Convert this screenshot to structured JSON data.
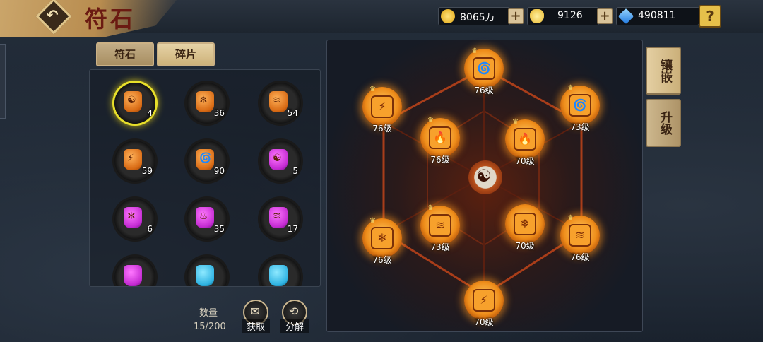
{
  "header": {
    "title": "符石",
    "back_icon": "back-arrow-icon",
    "resources": [
      {
        "name": "gold",
        "value": "8065万",
        "icon": "gold-coin-icon",
        "color": "#f2c232"
      },
      {
        "name": "ingot",
        "value": "9126",
        "icon": "gold-ingot-icon",
        "color": "#f6c84a"
      },
      {
        "name": "diamond",
        "value": "490811",
        "icon": "diamond-icon",
        "color": "#3aa6ff"
      }
    ],
    "help_label": "?"
  },
  "tabs": [
    {
      "label": "符石",
      "active": false
    },
    {
      "label": "碎片",
      "active": true
    }
  ],
  "inventory": {
    "items": [
      {
        "color": "orange",
        "glyph": "☯",
        "count": "4",
        "selected": true
      },
      {
        "color": "orange",
        "glyph": "❄",
        "count": "36"
      },
      {
        "color": "orange",
        "glyph": "≋",
        "count": "54"
      },
      {
        "color": "orange",
        "glyph": "⚡",
        "count": "59"
      },
      {
        "color": "orange",
        "glyph": "🌀",
        "count": "90"
      },
      {
        "color": "purple",
        "glyph": "☯",
        "count": "5"
      },
      {
        "color": "purple",
        "glyph": "❄",
        "count": "6"
      },
      {
        "color": "purple",
        "glyph": "♨",
        "count": "35"
      },
      {
        "color": "purple",
        "glyph": "≋",
        "count": "17"
      },
      {
        "color": "purple",
        "glyph": "",
        "count": ""
      },
      {
        "color": "blue",
        "glyph": "",
        "count": ""
      },
      {
        "color": "blue",
        "glyph": "",
        "count": ""
      }
    ]
  },
  "bottom": {
    "quantity_label": "数量",
    "quantity_value": "15/200",
    "acquire_label": "获取",
    "decompose_label": "分解"
  },
  "board": {
    "center_icon": "bagua-yinyang-icon",
    "nodes": [
      {
        "glyph": "🌀",
        "level": "76级",
        "crown": true
      },
      {
        "glyph": "⚡",
        "level": "76级",
        "crown": true
      },
      {
        "glyph": "🌀",
        "level": "73级",
        "crown": true
      },
      {
        "glyph": "🔥",
        "level": "76级",
        "crown": true
      },
      {
        "glyph": "🔥",
        "level": "70级",
        "crown": true
      },
      {
        "glyph": "❄",
        "level": "76级",
        "crown": true
      },
      {
        "glyph": "≋",
        "level": "73级",
        "crown": true
      },
      {
        "glyph": "❄",
        "level": "70级",
        "crown": false
      },
      {
        "glyph": "≋",
        "level": "76级",
        "crown": true
      },
      {
        "glyph": "⚡",
        "level": "70级",
        "crown": false
      }
    ]
  },
  "side_buttons": [
    {
      "label": "镶嵌",
      "active": true
    },
    {
      "label": "升级",
      "active": false
    }
  ]
}
